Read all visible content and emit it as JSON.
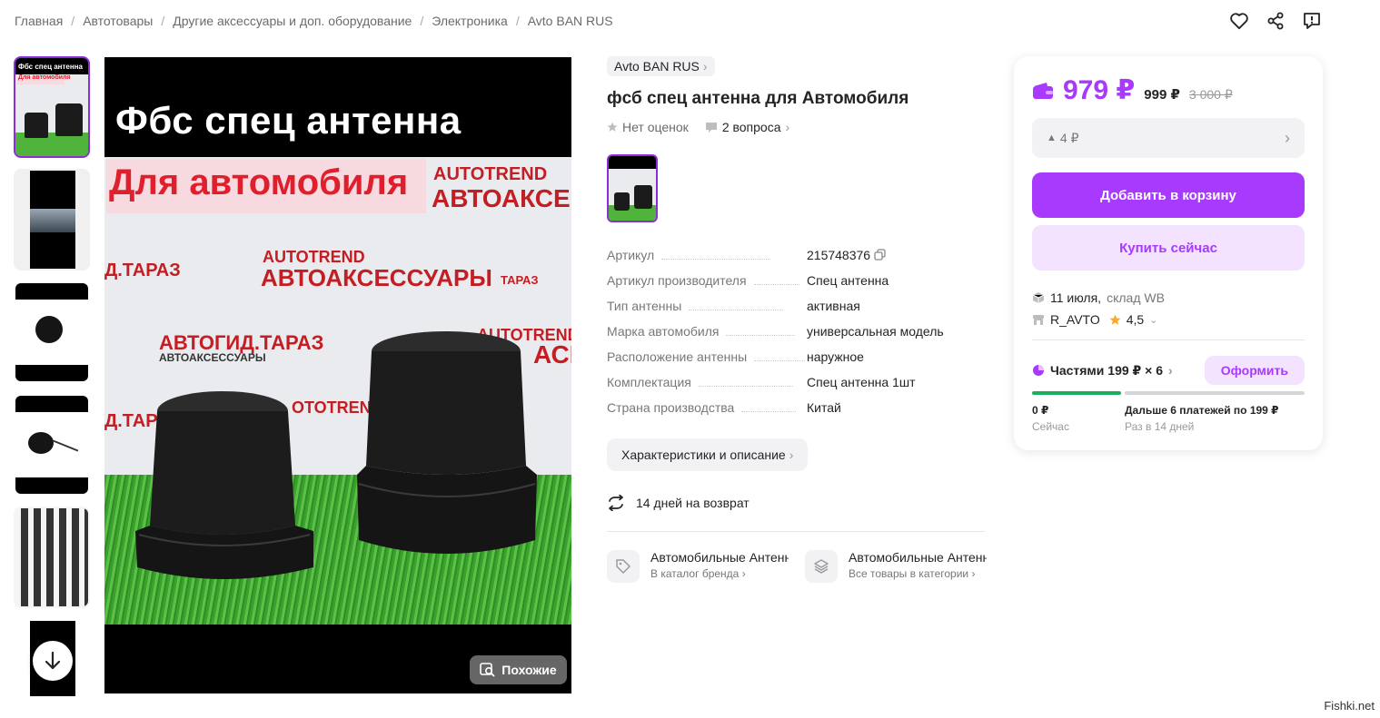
{
  "breadcrumbs": [
    "Главная",
    "Автотовары",
    "Другие аксессуары и доп. оборудование",
    "Электроника",
    "Avto BAN RUS"
  ],
  "header_icons": [
    "heart-icon",
    "share-icon",
    "report-icon"
  ],
  "gallery": {
    "headline": "Фбс  спец  антенна",
    "banner": "Для  автомобиля",
    "wall_texts": [
      "AUTOTREND",
      "АВТОАКСЕ",
      "Д.ТАРАЗ",
      "AUTOTREND",
      "АВТОАКСЕССУАРЫ",
      "ТАРАЗ",
      "АВТОГИД.ТАРАЗ",
      "АВТОАКСЕССУАРЫ",
      "AUTOTREND",
      "АСЕ",
      "OTOTREND",
      "Д.ТАРАЗ"
    ],
    "similar_label": "Похожие",
    "thumb_headline": "Фбс  спец  антенна",
    "thumb_banner": "Для  автомобиля"
  },
  "product": {
    "brand": "Avto BAN RUS",
    "title": "фсб спец антенна для Автомобиля",
    "rating": "Нет оценок",
    "questions": "2 вопроса",
    "specs": [
      {
        "k": "Артикул",
        "v": "215748376"
      },
      {
        "k": "Артикул производителя",
        "v": "Спец антенна"
      },
      {
        "k": "Тип антенны",
        "v": "активная"
      },
      {
        "k": "Марка автомобиля",
        "v": "универсальная модель"
      },
      {
        "k": "Расположение антенны",
        "v": "наружное"
      },
      {
        "k": "Комплектация",
        "v": "Спец антенна 1шт"
      },
      {
        "k": "Страна производства",
        "v": "Китай"
      }
    ],
    "desc_button": "Характеристики и описание",
    "return_text": "14 дней на возврат",
    "categories": [
      {
        "title": "Автомобильные Антенны",
        "sub": "В каталог бренда"
      },
      {
        "title": "Автомобильные Антенны",
        "sub": "Все товары в категории"
      }
    ]
  },
  "card": {
    "price": "979 ₽",
    "price_old": "999 ₽",
    "price_orig": "3 000 ₽",
    "drop": "4 ₽",
    "cart_label": "Добавить в корзину",
    "buy_label": "Купить сейчас",
    "delivery_date": "11 июля,",
    "delivery_warehouse": "склад WB",
    "seller": "R_AVTO",
    "seller_rating": "4,5",
    "parts_label": "Частями 199 ₽ × 6",
    "parts_button": "Оформить",
    "pay_now_amount": "0 ₽",
    "pay_now_label": "Сейчас",
    "pay_later_amount": "Дальше 6 платежей по 199 ₽",
    "pay_later_label": "Раз в 14 дней"
  },
  "colors": {
    "accent": "#a73afd",
    "thumb_border": "#8b2ed8",
    "progress": "#1bae5f"
  },
  "watermark": "Fishki.net"
}
